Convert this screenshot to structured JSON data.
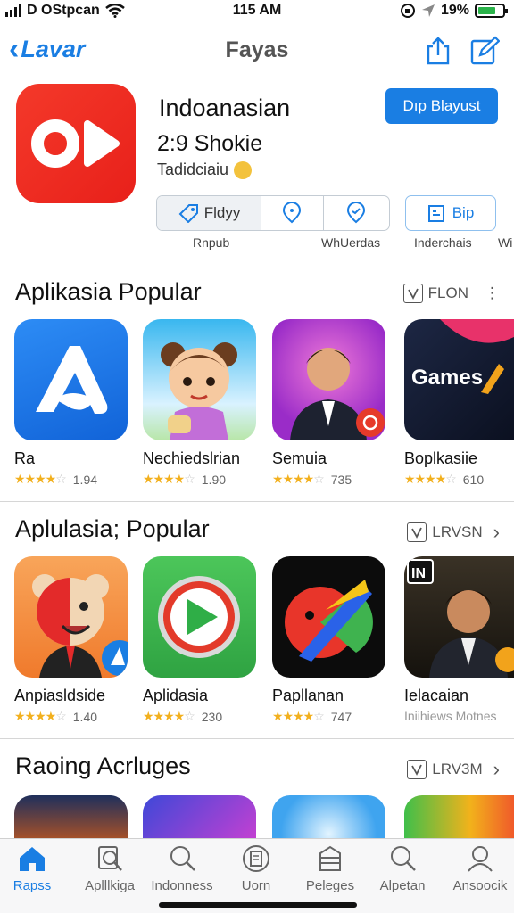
{
  "status": {
    "carrier": "D OStpcan",
    "time": "115 AM",
    "battery_pct": "19%"
  },
  "nav": {
    "back_label": "Lavar",
    "title": "Fayas"
  },
  "hero": {
    "name": "Indoanasian",
    "subtitle": "2:9 Shokie",
    "developer": "Tadidciaiu",
    "get_label": "Dıp Blayust",
    "seg": [
      "Fldyy",
      "",
      ""
    ],
    "bip_label": "Bip",
    "sublabels": [
      "Rnpub",
      "WhUerdas",
      "Inderchais",
      "Wi"
    ]
  },
  "sections": [
    {
      "title": "Aplikasia Popular",
      "more": "FLON",
      "more_suffix": "⋮",
      "apps": [
        {
          "name": "Ra",
          "rating": 4.0,
          "count": "1.94"
        },
        {
          "name": "Nechiedslrian",
          "rating": 4.5,
          "count": "1.90"
        },
        {
          "name": "Semuia",
          "rating": 4.0,
          "count": "735"
        },
        {
          "name": "Boplkasiie",
          "rating": 4.5,
          "count": "610"
        }
      ]
    },
    {
      "title": "Aplulasia; Popular",
      "more": "LRVSN",
      "more_suffix": "›",
      "apps": [
        {
          "name": "Anpiasldside",
          "rating": 4.5,
          "count": "1.40"
        },
        {
          "name": "Aplidasia",
          "rating": 4.5,
          "count": "230"
        },
        {
          "name": "Papllanan",
          "rating": 4.5,
          "count": "747"
        },
        {
          "name": "Ielacaian",
          "rating": null,
          "count": "Iniihiews Motnes"
        }
      ]
    },
    {
      "title": "Raoing Acrluges",
      "more": "LRV3M",
      "more_suffix": "›"
    }
  ],
  "icon_text": {
    "games_label": "Games",
    "linkedin_badge": "IN"
  },
  "tabs": [
    "Rapss",
    "Aplllkiga",
    "Indonness",
    "Uorn",
    "Peleges",
    "Alpetan",
    "Ansoocik"
  ],
  "colors": {
    "accent": "#1a7ee3",
    "star": "#f2b01e",
    "hero_icon": "#f0321f"
  }
}
